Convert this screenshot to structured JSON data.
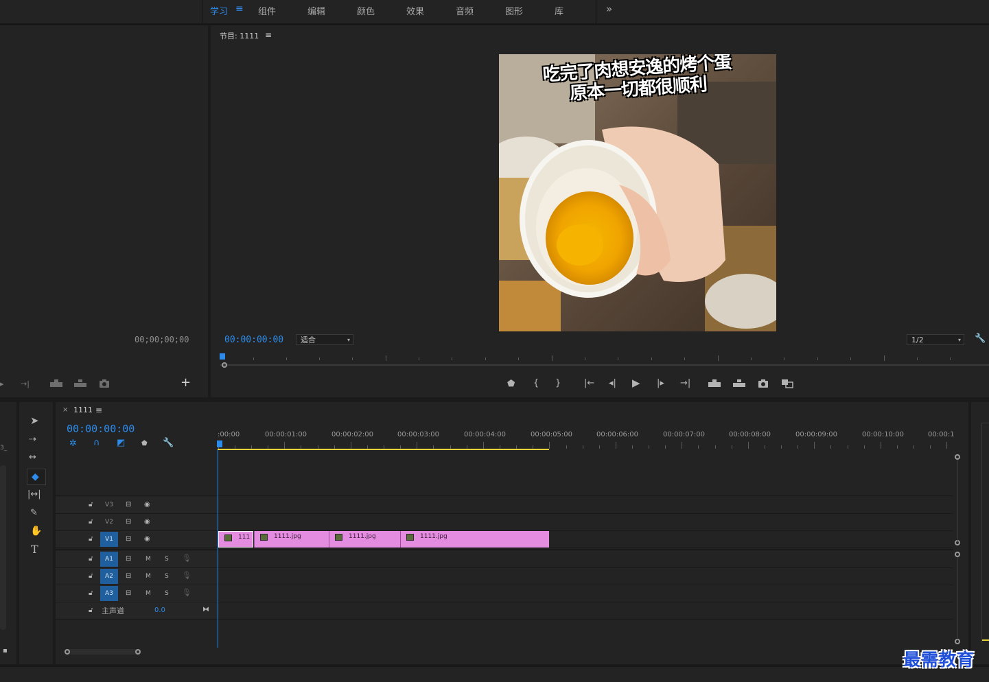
{
  "workspace_tabs": [
    {
      "label": "学习",
      "active": true
    },
    {
      "label": "组件",
      "active": false
    },
    {
      "label": "编辑",
      "active": false
    },
    {
      "label": "颜色",
      "active": false
    },
    {
      "label": "效果",
      "active": false
    },
    {
      "label": "音频",
      "active": false
    },
    {
      "label": "图形",
      "active": false
    },
    {
      "label": "库",
      "active": false
    }
  ],
  "source": {
    "timecode": "00;00;00;00"
  },
  "program": {
    "title": "节目: 1111",
    "timecode": "00:00:00:00",
    "zoom": "适合",
    "resolution": "1/2",
    "caption_line1": "吃完了肉想安逸的烤个蛋",
    "caption_line2": "原本一切都很顺利"
  },
  "timeline": {
    "sequence_name": "1111",
    "timecode": "00:00:00:00",
    "ruler_labels": [
      ":00:00",
      "00:00:01:00",
      "00:00:02:00",
      "00:00:03:00",
      "00:00:04:00",
      "00:00:05:00",
      "00:00:06:00",
      "00:00:07:00",
      "00:00:08:00",
      "00:00:09:00",
      "00:00:10:00",
      "00:00:1"
    ],
    "video_tracks": [
      {
        "name": "V3",
        "targeted": false
      },
      {
        "name": "V2",
        "targeted": false
      },
      {
        "name": "V1",
        "targeted": true
      }
    ],
    "audio_tracks": [
      {
        "name": "A1",
        "m": "M",
        "s": "S"
      },
      {
        "name": "A2",
        "m": "M",
        "s": "S"
      },
      {
        "name": "A3",
        "m": "M",
        "s": "S"
      }
    ],
    "master": {
      "label": "主声道",
      "value": "0.0"
    },
    "clips": [
      {
        "label": "111"
      },
      {
        "label": "1111.jpg"
      },
      {
        "label": "1111.jpg"
      },
      {
        "label": "1111.jpg"
      }
    ]
  },
  "source_partial_label": "3_",
  "watermark": "最需教育",
  "colors": {
    "accent": "#2d8ceb",
    "clip": "#e48ce0",
    "panel": "#232323",
    "work_area": "#e8d43a"
  }
}
